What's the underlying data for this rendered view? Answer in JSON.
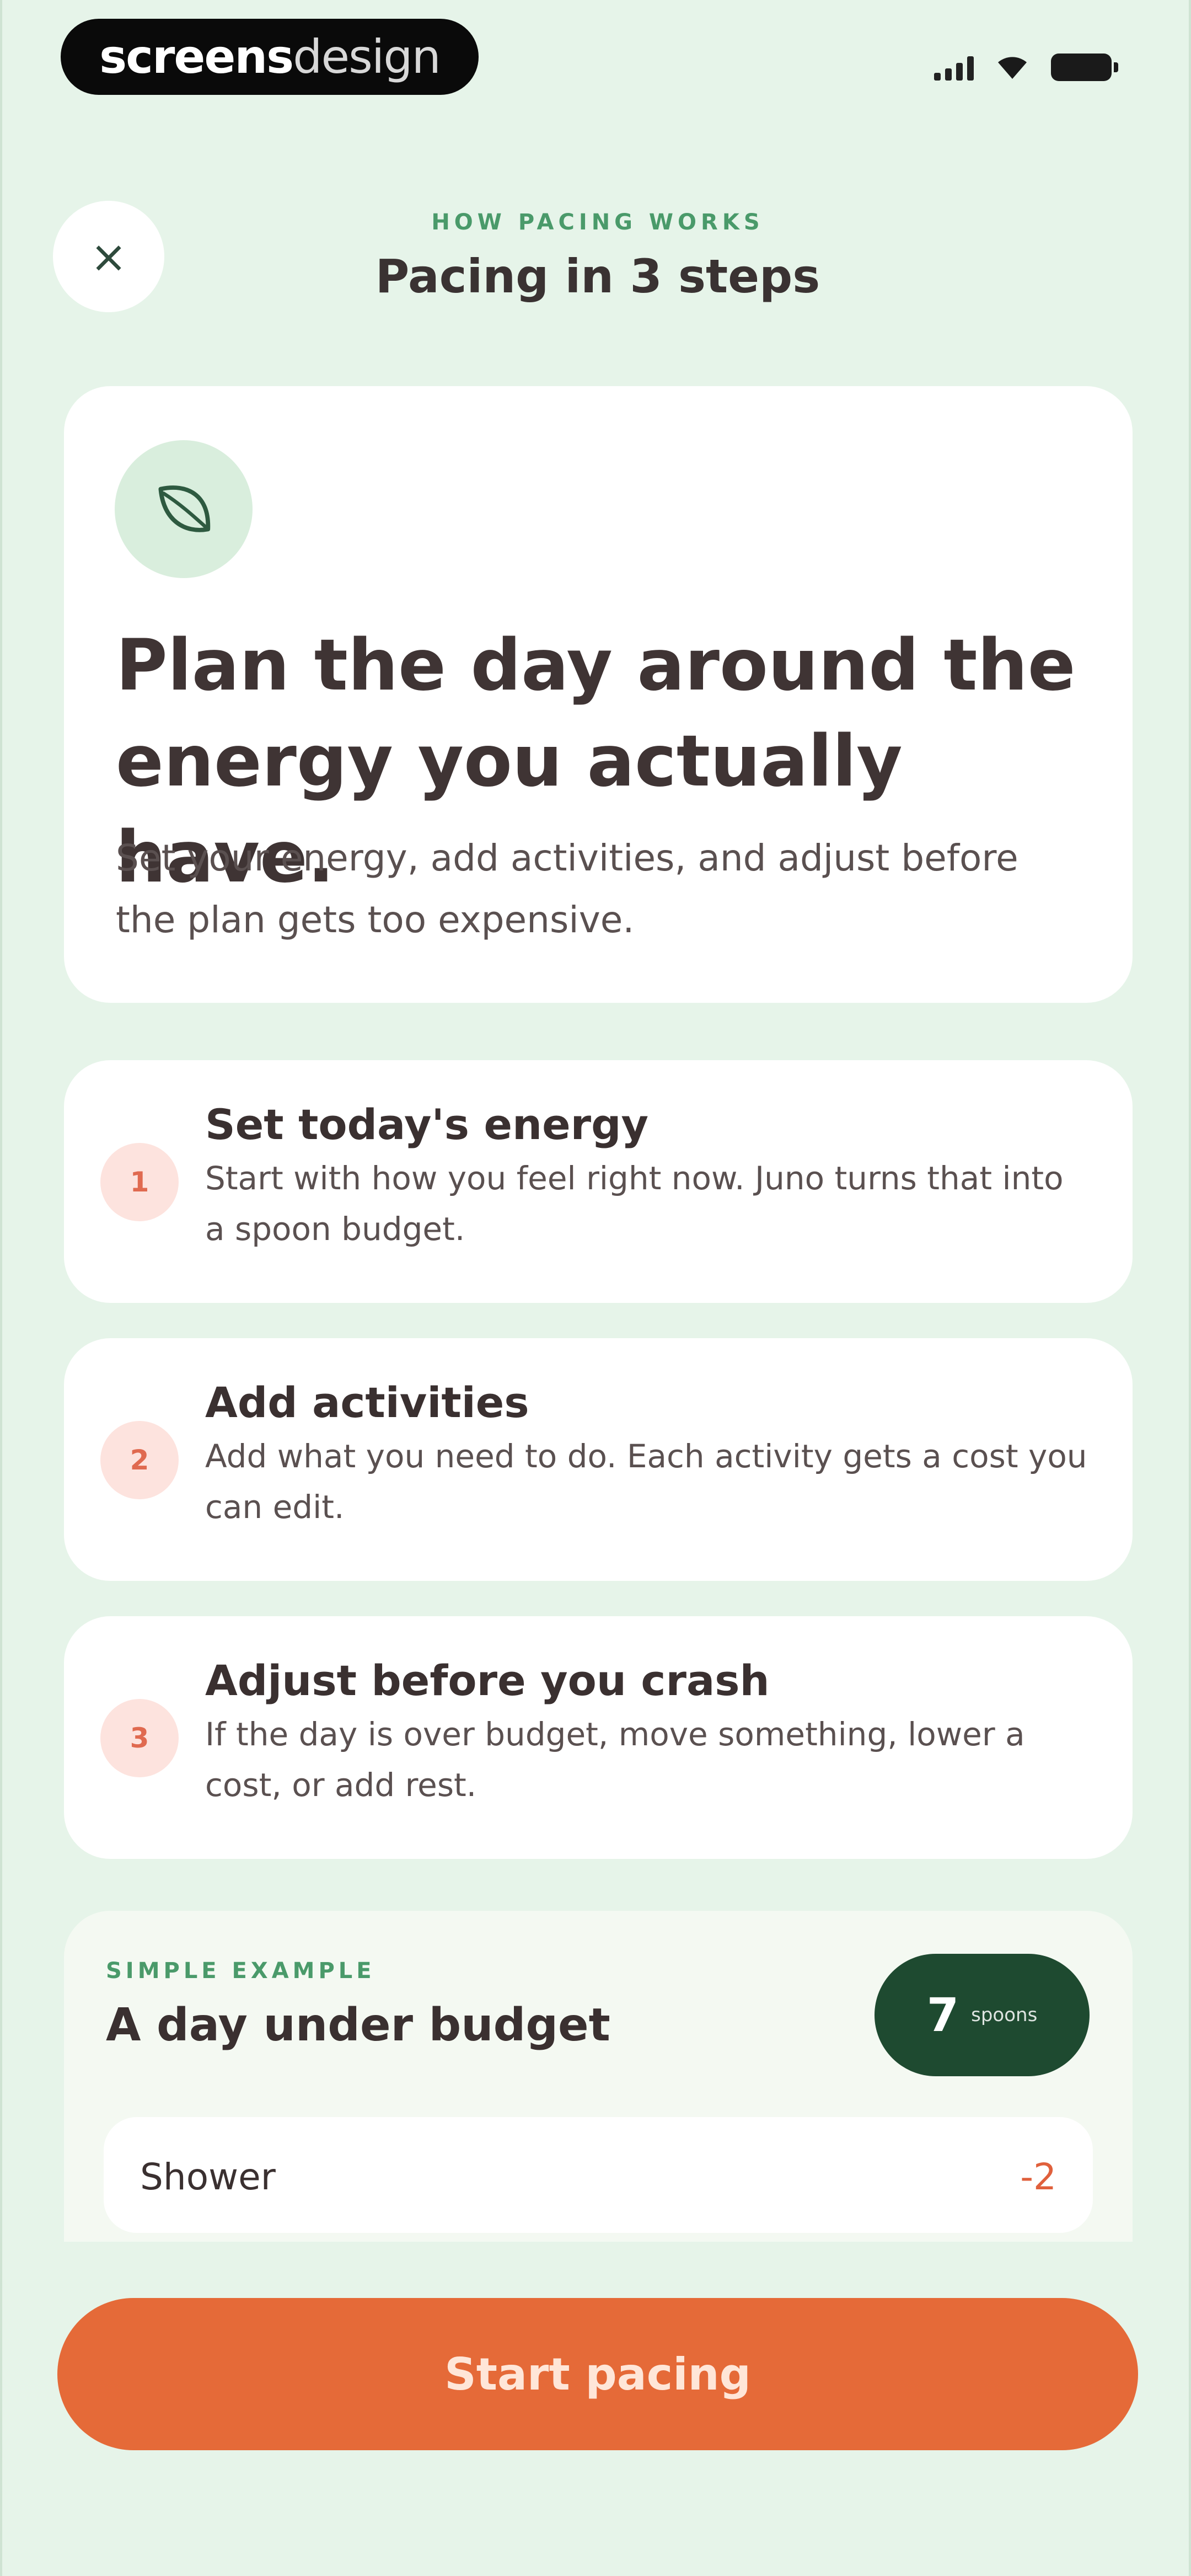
{
  "status_bar": {
    "brand_bold": "screens",
    "brand_light": "design"
  },
  "header": {
    "eyebrow": "HOW PACING WORKS",
    "title": "Pacing in 3 steps",
    "close_icon": "×"
  },
  "hero": {
    "icon": "leaf-icon",
    "title": "Plan the day around the energy you actually have.",
    "body": "Set your energy, add activities, and adjust before the plan gets too expensive."
  },
  "steps": [
    {
      "number": "1",
      "title": "Set today's energy",
      "body": "Start with how you feel right now. Juno turns that into a spoon budget."
    },
    {
      "number": "2",
      "title": "Add activities",
      "body": "Add what you need to do. Each activity gets a cost you can edit."
    },
    {
      "number": "3",
      "title": "Adjust before you crash",
      "body": "If the day is over budget, move something, lower a cost, or add rest."
    }
  ],
  "example": {
    "eyebrow": "SIMPLE EXAMPLE",
    "title": "A day under budget",
    "spoons_value": "7",
    "spoons_unit": "spoons",
    "activities": [
      {
        "name": "Shower",
        "cost": "-2"
      }
    ]
  },
  "primary_button": {
    "label": "Start pacing"
  },
  "colors": {
    "background": "#e6f4e9",
    "accent_orange": "#e56a38",
    "dark_green": "#1e4a30",
    "eyebrow_green": "#4a9a6a",
    "step_badge": "#fde3de"
  }
}
